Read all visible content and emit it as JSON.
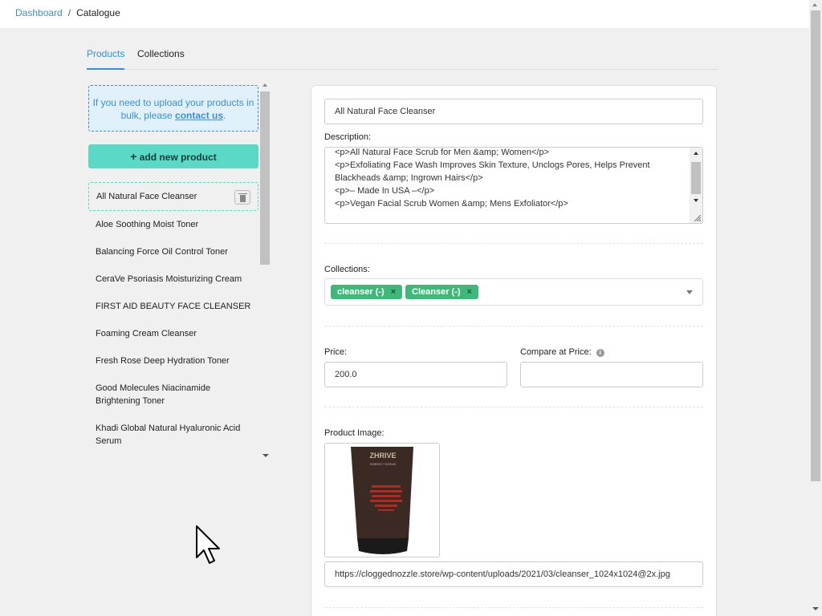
{
  "breadcrumb": {
    "parent": "Dashboard",
    "separator": "/",
    "current": "Catalogue"
  },
  "tabs": [
    {
      "label": "Products"
    },
    {
      "label": "Collections"
    }
  ],
  "sidebar": {
    "notice_text": "If you need to upload your products in bulk, please",
    "notice_link": "contact us",
    "notice_end": ".",
    "add_button": "add new product",
    "add_button_icon": "+",
    "products": [
      {
        "name": "All Natural Face Cleanser"
      },
      {
        "name": "Aloe Soothing Moist Toner"
      },
      {
        "name": "Balancing Force Oil Control Toner"
      },
      {
        "name": "CeraVe Psoriasis Moisturizing Cream"
      },
      {
        "name": "FIRST AID BEAUTY FACE CLEANSER"
      },
      {
        "name": "Foaming Cream Cleanser"
      },
      {
        "name": "Fresh Rose Deep Hydration Toner"
      },
      {
        "name": "Good Molecules Niacinamide Brightening Toner"
      },
      {
        "name": "Khadi Global Natural Hyaluronic Acid Serum"
      }
    ]
  },
  "form": {
    "title_value": "All Natural Face Cleanser",
    "description_label": "Description:",
    "description_lines": [
      "<p>All Natural Face Scrub for Men &amp; Women</p>",
      "<p>Exfoliating Face Wash Improves Skin Texture, Unclogs Pores, Helps Prevent Blackheads &amp; Ingrown Hairs</p>",
      "<p>– Made In USA –</p>",
      "<p>Vegan Facial Scrub Women &amp; Mens Exfoliator</p>"
    ],
    "collections_label": "Collections:",
    "collections": [
      {
        "label": "cleanser (-)"
      },
      {
        "label": "Cleanser (-)"
      }
    ],
    "tag_remove": "×",
    "price_label": "Price:",
    "price_value": "200.0",
    "compare_label": "Compare at Price:",
    "compare_value": "",
    "info_glyph": "i",
    "image_label": "Product Image:",
    "image_url": "https://cloggednozzle.store/wp-content/uploads/2021/03/cleanser_1024x1024@2x.jpg",
    "product_tube_text": [
      "ZHRIVE",
      "ENERGY SCRUB"
    ]
  },
  "colors": {
    "accent": "#3a8fd4",
    "button": "#5ad9c6",
    "tag": "#3fb87a"
  },
  "icons": {
    "trash": "trash-icon",
    "cursor": "mouse-cursor-icon",
    "info": "info-icon",
    "caret": "chevron-down-icon"
  }
}
